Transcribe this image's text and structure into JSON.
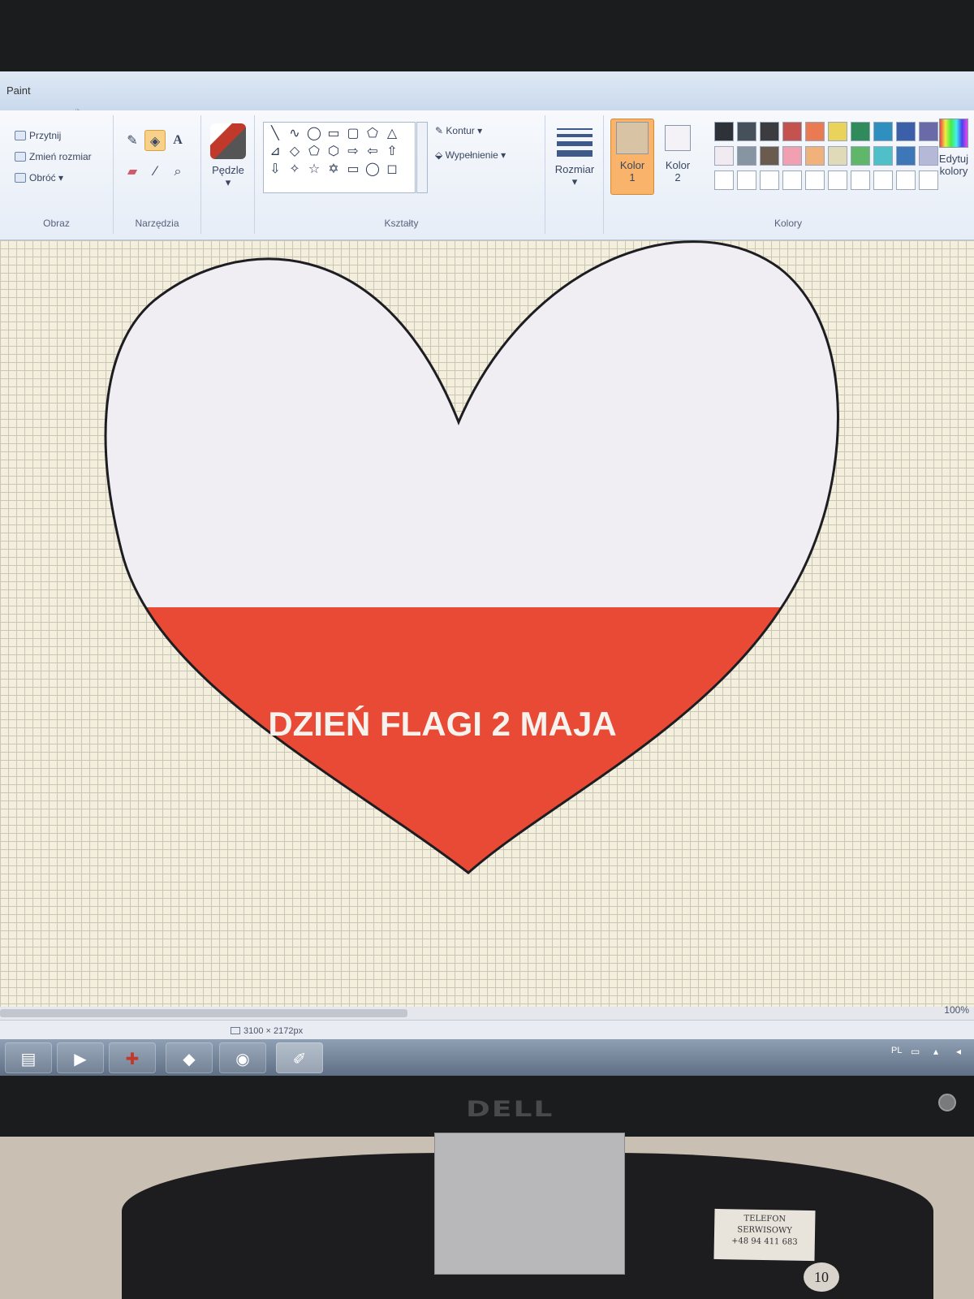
{
  "app": {
    "title": "Paint"
  },
  "ribbon": {
    "image_group": {
      "label": "Obraz",
      "crop": "Przytnij",
      "resize": "Zmień rozmiar",
      "rotate": "Obróć"
    },
    "tools_group": {
      "label": "Narzędzia"
    },
    "brushes": {
      "label": "Pędzle"
    },
    "shapes_group": {
      "label": "Kształty",
      "outline": "Kontur",
      "fill": "Wypełnienie",
      "shapes": [
        "╲",
        "∿",
        "◯",
        "▭",
        "▢",
        "⬠",
        "△",
        "⊿",
        "◇",
        "⬠",
        "⬡",
        "⇨",
        "⇦",
        "⇧",
        "⇩",
        "✧",
        "☆",
        "✡",
        "▭",
        "◯",
        "◻"
      ]
    },
    "size": {
      "label": "Rozmiar"
    },
    "color1": {
      "label": "Kolor",
      "number": "1",
      "value": "#d8c4a4"
    },
    "color2": {
      "label": "Kolor",
      "number": "2",
      "value": "#f4f2f6"
    },
    "colors_group": {
      "label": "Kolory",
      "row1": [
        "#2e3238",
        "#45505a",
        "#3c3c40",
        "#c4524e",
        "#ea7a52",
        "#e9d35a",
        "#2f8b5a",
        "#2f8fbf",
        "#3b5fa8",
        "#6a6aa8"
      ],
      "row2": [
        "#f1eaf0",
        "#8795a3",
        "#6b5a4e",
        "#f0a0b0",
        "#f0b27a",
        "#e0dab8",
        "#5fb86a",
        "#4fc0c8",
        "#3d77b8",
        "#b6b8d8"
      ],
      "row3": [
        "#ffffff",
        "#ffffff",
        "#ffffff",
        "#ffffff",
        "#ffffff",
        "#ffffff",
        "#ffffff",
        "#ffffff",
        "#ffffff",
        "#ffffff"
      ]
    },
    "edit_colors": {
      "line1": "Edytuj",
      "line2": "kolory"
    }
  },
  "canvas": {
    "text": "DZIEŃ FLAGI 2 MAJA",
    "colors": {
      "top": "#f0eef2",
      "bottom": "#e84a35",
      "outline": "#1e1e22"
    }
  },
  "status": {
    "canvas_size": "3100 × 2172px",
    "zoom": "100%"
  },
  "taskbar": {
    "language": "PL",
    "buttons": [
      "file-explorer-icon",
      "media-player-icon",
      "shield-icon",
      "folder-icon",
      "chrome-icon",
      "paint-icon"
    ]
  },
  "monitor": {
    "brand": "DELL"
  },
  "sticker": {
    "line1": "TELEFON",
    "line2": "SERWISOWY",
    "line3": "+48 94 411 683",
    "number": "10"
  }
}
